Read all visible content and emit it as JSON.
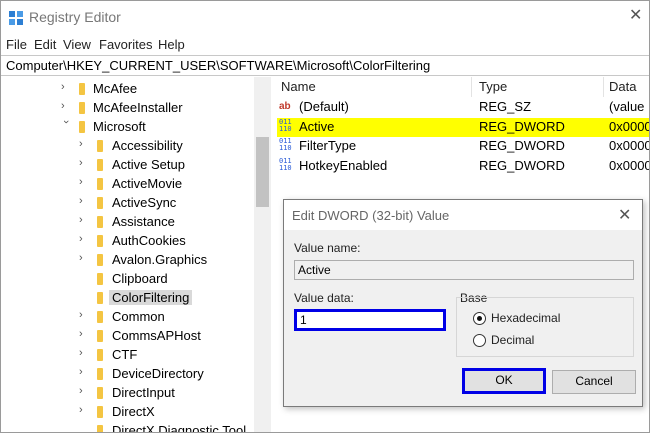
{
  "window": {
    "title": "Registry Editor",
    "close_glyph": "✕"
  },
  "menu": [
    "File",
    "Edit",
    "View",
    "Favorites",
    "Help"
  ],
  "address": "Computer\\HKEY_CURRENT_USER\\SOFTWARE\\Microsoft\\ColorFiltering",
  "tree": {
    "items": [
      {
        "label": "McAfee",
        "expanded": false
      },
      {
        "label": "McAfeeInstaller",
        "expanded": false
      },
      {
        "label": "Microsoft",
        "expanded": true
      },
      {
        "label": "Accessibility",
        "expanded": false
      },
      {
        "label": "Active Setup",
        "expanded": false
      },
      {
        "label": "ActiveMovie",
        "expanded": false
      },
      {
        "label": "ActiveSync",
        "expanded": false
      },
      {
        "label": "Assistance",
        "expanded": false
      },
      {
        "label": "AuthCookies",
        "expanded": false
      },
      {
        "label": "Avalon.Graphics",
        "expanded": false
      },
      {
        "label": "Clipboard",
        "expanded": false
      },
      {
        "label": "ColorFiltering",
        "selected": true
      },
      {
        "label": "Common",
        "expanded": false
      },
      {
        "label": "CommsAPHost",
        "expanded": false
      },
      {
        "label": "CTF",
        "expanded": false
      },
      {
        "label": "DeviceDirectory",
        "expanded": false
      },
      {
        "label": "DirectInput",
        "expanded": false
      },
      {
        "label": "DirectX",
        "expanded": false
      },
      {
        "label": "DirectX Diagnostic Tool",
        "expanded": false
      }
    ]
  },
  "list": {
    "headers": {
      "name": "Name",
      "type": "Type",
      "data": "Data"
    },
    "rows": [
      {
        "icon": "string-value-icon",
        "name": "(Default)",
        "type": "REG_SZ",
        "data": "(value r"
      },
      {
        "icon": "dword-value-icon",
        "name": "Active",
        "type": "REG_DWORD",
        "data": "0x0000",
        "highlight": true
      },
      {
        "icon": "dword-value-icon",
        "name": "FilterType",
        "type": "REG_DWORD",
        "data": "0x0000"
      },
      {
        "icon": "dword-value-icon",
        "name": "HotkeyEnabled",
        "type": "REG_DWORD",
        "data": "0x0000"
      }
    ]
  },
  "dialog": {
    "title": "Edit DWORD (32-bit) Value",
    "value_name_label": "Value name:",
    "value_name": "Active",
    "value_data_label": "Value data:",
    "value_data": "1",
    "base_label": "Base",
    "hex_label": "Hexadecimal",
    "dec_label": "Decimal",
    "selected_base": "Hexadecimal",
    "ok_label": "OK",
    "cancel_label": "Cancel"
  },
  "colors": {
    "highlight": "#ffff00",
    "focus_outline": "#0000e6",
    "folder": "#f4c542"
  }
}
